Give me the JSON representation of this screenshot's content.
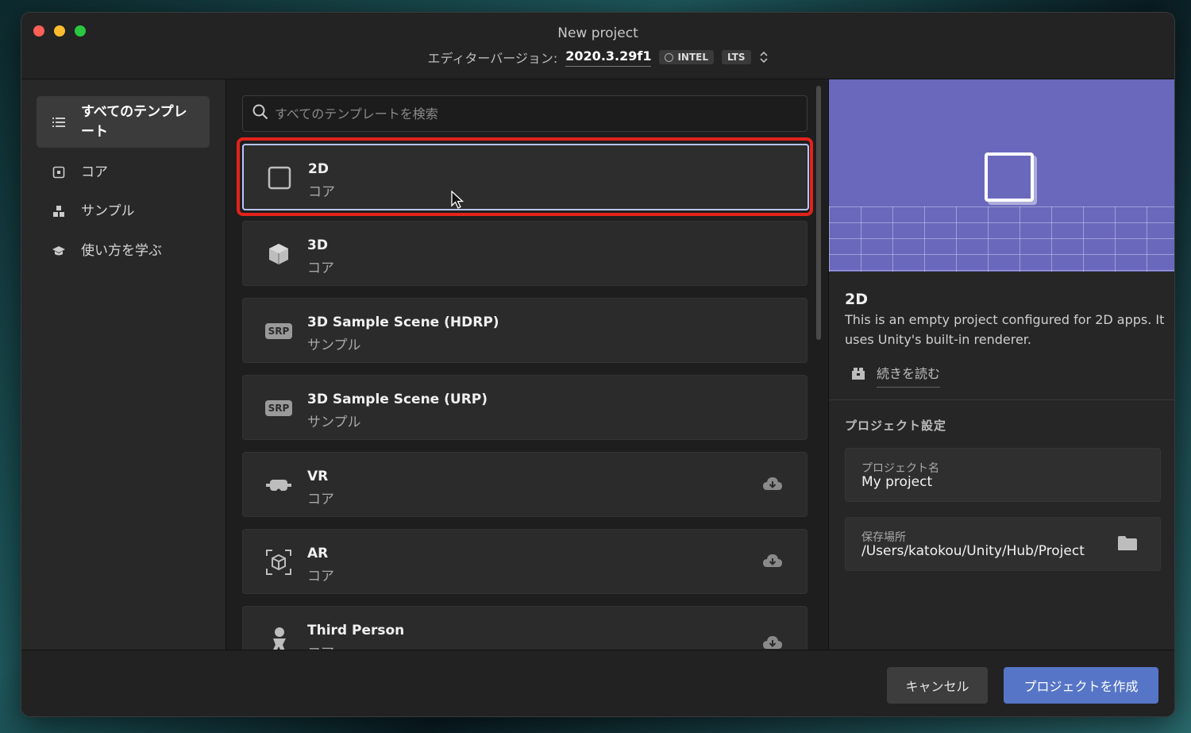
{
  "window": {
    "title": "New project",
    "editor_label": "エディターバージョン:",
    "editor_version": "2020.3.29f1",
    "chip_arch": "INTEL",
    "chip_lts": "LTS"
  },
  "sidebar": {
    "items": [
      {
        "label": "すべてのテンプレート",
        "icon": "list-icon",
        "active": true
      },
      {
        "label": "コア",
        "icon": "core-icon"
      },
      {
        "label": "サンプル",
        "icon": "sample-icon"
      },
      {
        "label": "使い方を学ぶ",
        "icon": "learn-icon"
      }
    ]
  },
  "search": {
    "placeholder": "すべてのテンプレートを検索"
  },
  "templates": [
    {
      "title": "2D",
      "category": "コア",
      "icon": "square-icon",
      "selected": true
    },
    {
      "title": "3D",
      "category": "コア",
      "icon": "cube-icon"
    },
    {
      "title": "3D Sample Scene (HDRP)",
      "category": "サンプル",
      "icon": "srp-icon",
      "badge": "SRP"
    },
    {
      "title": "3D Sample Scene (URP)",
      "category": "サンプル",
      "icon": "srp-icon",
      "badge": "SRP"
    },
    {
      "title": "VR",
      "category": "コア",
      "icon": "vr-headset-icon",
      "download": true
    },
    {
      "title": "AR",
      "category": "コア",
      "icon": "ar-cube-icon",
      "download": true
    },
    {
      "title": "Third Person",
      "category": "コア",
      "icon": "person-icon",
      "download": true
    }
  ],
  "details": {
    "title": "2D",
    "description": "This is an empty project configured for 2D apps. It uses Unity's built-in renderer.",
    "read_more": "続きを読む",
    "preview_color": "#6a68bd"
  },
  "settings": {
    "section_title": "プロジェクト設定",
    "name_label": "プロジェクト名",
    "name_value": "My project",
    "location_label": "保存場所",
    "location_value": "/Users/katokou/Unity/Hub/Project"
  },
  "footer": {
    "cancel": "キャンセル",
    "create": "プロジェクトを作成"
  }
}
